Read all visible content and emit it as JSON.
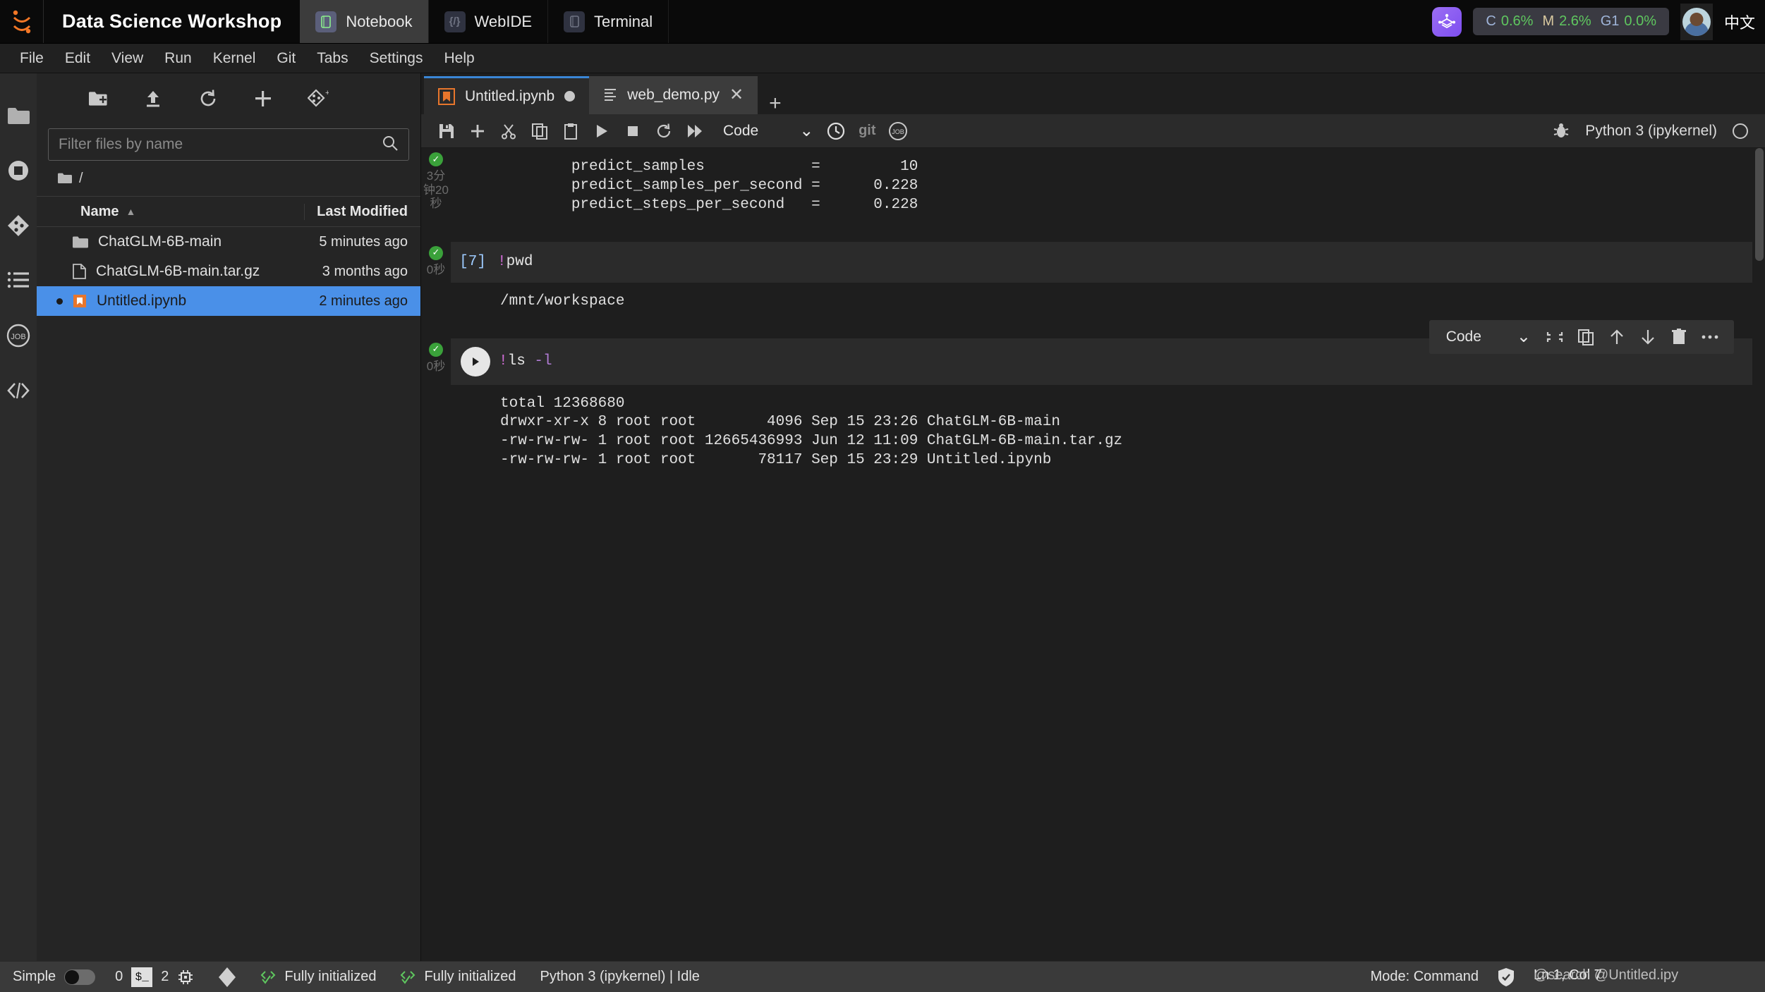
{
  "topbar": {
    "brand": "Data Science Workshop",
    "logo_icon": "jupyter-logo-icon",
    "nav": [
      {
        "label": "Notebook",
        "icon": "notebook-icon",
        "active": true
      },
      {
        "label": "WebIDE",
        "icon": "code-brackets-icon",
        "active": false
      },
      {
        "label": "Terminal",
        "icon": "terminal-icon",
        "active": false
      }
    ],
    "badge_icon": "cube-badge-icon",
    "stats": {
      "cpu_key": "C",
      "cpu_value": "0.6%",
      "mem_key": "M",
      "mem_value": "2.6%",
      "gpu_key": "G1",
      "gpu_value": "0.0%"
    },
    "avatar_icon": "user-avatar",
    "ime_indicator": "中文"
  },
  "menubar": {
    "items": [
      "File",
      "Edit",
      "View",
      "Run",
      "Kernel",
      "Git",
      "Tabs",
      "Settings",
      "Help"
    ]
  },
  "rail": {
    "items": [
      {
        "name": "file-browser-icon",
        "label": "File Browser"
      },
      {
        "name": "running-terminals-icon",
        "label": "Running Terminals and Kernels"
      },
      {
        "name": "git-icon",
        "label": "Git"
      },
      {
        "name": "table-of-contents-icon",
        "label": "Table of Contents"
      },
      {
        "name": "jobs-icon",
        "label": "Notebook Jobs"
      },
      {
        "name": "extension-manager-icon",
        "label": "Extension Manager"
      }
    ]
  },
  "filebrowser": {
    "toolbar": [
      {
        "name": "new-folder-icon",
        "label": "New Folder"
      },
      {
        "name": "upload-icon",
        "label": "Upload Files"
      },
      {
        "name": "refresh-icon",
        "label": "Refresh File List"
      },
      {
        "name": "new-launcher-icon",
        "label": "New Launcher"
      },
      {
        "name": "git-clone-icon",
        "label": "Git Clone"
      }
    ],
    "filter_placeholder": "Filter files by name",
    "filter_value": "",
    "search_icon": "search-icon",
    "breadcrumb": "/",
    "columns": {
      "name": "Name",
      "modified": "Last Modified"
    },
    "sort_indicator": "▲",
    "rows": [
      {
        "name": "ChatGLM-6B-main",
        "modified": "5 minutes ago",
        "icon": "folder-icon",
        "selected": false,
        "dirty": false
      },
      {
        "name": "ChatGLM-6B-main.tar.gz",
        "modified": "3 months ago",
        "icon": "file-icon",
        "selected": false,
        "dirty": false
      },
      {
        "name": "Untitled.ipynb",
        "modified": "2 minutes ago",
        "icon": "notebook-file-icon",
        "selected": true,
        "dirty": true
      }
    ]
  },
  "tabs": [
    {
      "label": "Untitled.ipynb",
      "icon": "notebook-file-icon",
      "active": true,
      "modified": true
    },
    {
      "label": "web_demo.py",
      "icon": "python-file-icon",
      "active": false,
      "closable": true
    }
  ],
  "tab_add_label": "+",
  "notebook_toolbar": {
    "buttons": [
      {
        "name": "save-button",
        "glyph": "save"
      },
      {
        "name": "insert-cell-button",
        "glyph": "plus"
      },
      {
        "name": "cut-cells-button",
        "glyph": "scissors"
      },
      {
        "name": "copy-cells-button",
        "glyph": "copy"
      },
      {
        "name": "paste-cells-button",
        "glyph": "paste"
      },
      {
        "name": "run-cell-button",
        "glyph": "play"
      },
      {
        "name": "interrupt-kernel-button",
        "glyph": "stop"
      },
      {
        "name": "restart-kernel-button",
        "glyph": "restart"
      },
      {
        "name": "restart-run-all-button",
        "glyph": "fast-forward"
      }
    ],
    "celltype_value": "Code",
    "chevron": "⌄",
    "right_icons": [
      {
        "name": "execution-time-icon",
        "glyph": "clock"
      },
      {
        "name": "git-toolbar-icon",
        "glyph": "git"
      },
      {
        "name": "jobs-toolbar-icon",
        "glyph": "job"
      }
    ],
    "debugger_icon": "bug-icon",
    "kernel_name": "Python 3 (ipykernel)",
    "kernel_status_icon": "kernel-idle-circle"
  },
  "cells": [
    {
      "type": "output-only",
      "status_icon": "check-success",
      "duration": "3分钟20秒",
      "output": "        predict_samples            =         10\n        predict_samples_per_second =      0.228\n        predict_steps_per_second   =      0.228"
    },
    {
      "type": "code",
      "status_icon": "check-success",
      "duration": "0秒",
      "prompt": "[7]",
      "source_bang": "!",
      "source_text": "pwd",
      "output": "/mnt/workspace"
    },
    {
      "type": "code",
      "status_icon": "check-success",
      "duration": "0秒",
      "active": true,
      "run_icon": "play-circle-icon",
      "source_bang": "!",
      "source_text": "ls ",
      "source_flag": "-l",
      "output": "total 12368680\ndrwxr-xr-x 8 root root        4096 Sep 15 23:26 ChatGLM-6B-main\n-rw-rw-rw- 1 root root 12665436993 Jun 12 11:09 ChatGLM-6B-main.tar.gz\n-rw-rw-rw- 1 root root       78117 Sep 15 23:29 Untitled.ipynb"
    }
  ],
  "cell_toolbar": {
    "celltype_value": "Code",
    "chevron": "⌄",
    "buttons": [
      {
        "name": "collapse-cell-button",
        "glyph": "collapse"
      },
      {
        "name": "duplicate-cell-button",
        "glyph": "copy"
      },
      {
        "name": "move-cell-up-button",
        "glyph": "arrow-up"
      },
      {
        "name": "move-cell-down-button",
        "glyph": "arrow-down"
      },
      {
        "name": "delete-cell-button",
        "glyph": "trash"
      },
      {
        "name": "more-options-button",
        "glyph": "ellipsis"
      }
    ]
  },
  "statusbar": {
    "simple_label": "Simple",
    "simple_toggle_on": false,
    "terminal_count": "0",
    "kernel_badge": "$_",
    "kernel_count": "2",
    "cpu_icon": "chip-icon",
    "git_icon": "git-status-icon",
    "init_left": "Fully initialized",
    "init_right": "Fully initialized",
    "kernel_status": "Python 3 (ipykernel) | Idle",
    "mode": "Mode: Command",
    "shield_icon": "shield-check-icon",
    "cursor_position": "Ln 1, Col 7",
    "overlap_text": "@search @Untitled.ipy"
  }
}
